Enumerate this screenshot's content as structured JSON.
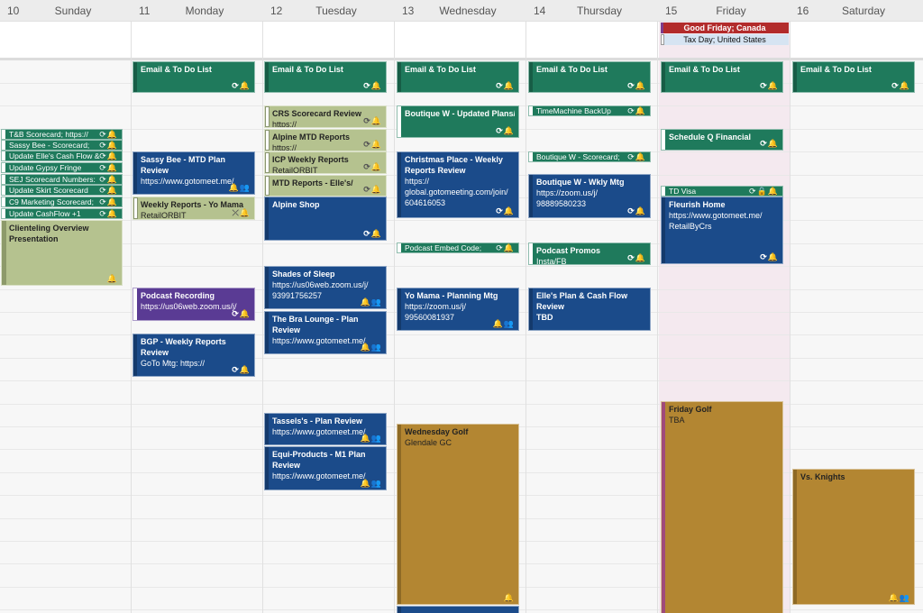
{
  "days": [
    {
      "num": "10",
      "name": "Sunday"
    },
    {
      "num": "11",
      "name": "Monday"
    },
    {
      "num": "12",
      "name": "Tuesday"
    },
    {
      "num": "13",
      "name": "Wednesday"
    },
    {
      "num": "14",
      "name": "Thursday"
    },
    {
      "num": "15",
      "name": "Friday"
    },
    {
      "num": "16",
      "name": "Saturday"
    }
  ],
  "holidays": [
    {
      "label": "Good Friday; Canada",
      "color": "#b22b2b"
    },
    {
      "label": "Tax Day; United States",
      "color": "#d6e4f2"
    }
  ],
  "icons": {
    "repeat_alarm": "⟳🔔",
    "alarm_invitees": "🔔👥",
    "alarm": "🔔",
    "repeat_lock_alarm": "⟳🔒🔔",
    "nosync_alarm": "⤫🔔"
  },
  "events": {
    "sun": [
      {
        "title": "T&B Scorecard; https://"
      },
      {
        "title": "Sassy Bee - Scorecard;"
      },
      {
        "title": "Update Elle's Cash Flow &"
      },
      {
        "title": "Update Gypsy Fringe"
      },
      {
        "title": "SEJ Scorecard Numbers:"
      },
      {
        "title": "Update Skirt Scorecard"
      },
      {
        "title": "C9 Marketing Scorecard;"
      },
      {
        "title": "Update CashFlow +1"
      },
      {
        "title": "Clienteling Overview Presentation"
      }
    ],
    "mon": [
      {
        "title": "Email & To Do List"
      },
      {
        "title": "Sassy Bee - MTD Plan Review",
        "sub": "https://www.gotomeet.me/"
      },
      {
        "title": "Weekly Reports - Yo Mama",
        "sub": "RetailORBIT"
      },
      {
        "title": "Podcast Recording",
        "sub": "https://us06web.zoom.us/j/"
      },
      {
        "title": "BGP - Weekly Reports Review",
        "sub": "GoTo Mtg: https://"
      }
    ],
    "tue": [
      {
        "title": "Email & To Do List"
      },
      {
        "title": "CRS Scorecard Review",
        "sub": "https://"
      },
      {
        "title": "Alpine MTD Reports",
        "sub": "https://"
      },
      {
        "title": "ICP Weekly Reports",
        "sub": "RetailORBIT"
      },
      {
        "title": "MTD Reports - Elle's/"
      },
      {
        "title": "Alpine Shop"
      },
      {
        "title": "Shades of Sleep",
        "sub": "https://us06web.zoom.us/j/ 93991756257"
      },
      {
        "title": "The Bra Lounge - Plan Review",
        "sub": "https://www.gotomeet.me/"
      },
      {
        "title": "Tassels's - Plan Review",
        "sub": "https://www.gotomeet.me/"
      },
      {
        "title": "Equi-Products - M1 Plan Review",
        "sub": "https://www.gotomeet.me/"
      }
    ],
    "wed": [
      {
        "title": "Email & To Do List"
      },
      {
        "title": "Boutique W - Updated Plans/"
      },
      {
        "title": "Christmas Place - Weekly Reports Review",
        "sub": "https:// global.gotomeeting.com/join/ 604616053"
      },
      {
        "title": "Podcast Embed Code;"
      },
      {
        "title": "Yo Mama - Planning Mtg",
        "sub": "https://zoom.us/j/ 99560081937"
      },
      {
        "title": "Wednesday Golf",
        "sub": "Glendale GC"
      }
    ],
    "thu": [
      {
        "title": "Email & To Do List"
      },
      {
        "title": "TimeMachine BackUp"
      },
      {
        "title": "Boutique W - Scorecard;"
      },
      {
        "title": "Boutique W - Wkly Mtg",
        "sub": "https://zoom.us/j/ 98889580233"
      },
      {
        "title": "Podcast Promos",
        "sub": "Insta/FB"
      },
      {
        "title": "Elle's Plan & Cash Flow Review",
        "sub": "TBD"
      }
    ],
    "fri": [
      {
        "title": "Email & To Do List"
      },
      {
        "title": "Schedule Q Financial"
      },
      {
        "title": "TD Visa"
      },
      {
        "title": "Fleurish Home",
        "sub": "https://www.gotomeet.me/ RetailByCrs"
      },
      {
        "title": "Friday Golf",
        "sub": "TBA"
      }
    ],
    "sat": [
      {
        "title": "Email & To Do List"
      },
      {
        "title": "Vs. Knights"
      }
    ]
  },
  "colors": {
    "green": "#1f7a5c",
    "blue": "#1b4b8a",
    "olive": "#b5c28f",
    "purple": "#5a3b94",
    "gold": "#b38632",
    "friday_highlight": "#f4e9ef"
  }
}
